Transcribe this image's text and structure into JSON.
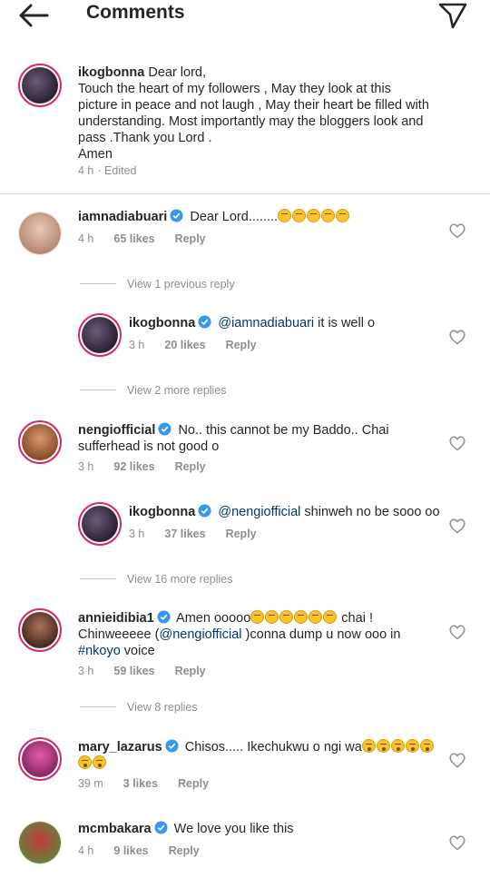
{
  "header": {
    "title": "Comments"
  },
  "caption": {
    "username": "ikogbonna",
    "text_lines": [
      "Dear lord,",
      "Touch the heart of my followers , May they look at this",
      "picture in peace and not laugh , May their heart be filled with",
      "understanding. Most importantly may the bloggers look and",
      "pass .Thank you Lord .",
      "Amen"
    ],
    "time": "4 h",
    "edited": "· Edited"
  },
  "comments": [
    {
      "username": "iamnadiabuari",
      "text": "Dear Lord........",
      "emoji_count": 5,
      "time": "4 h",
      "likes": "65 likes",
      "reply": "Reply"
    },
    {
      "username": "ikogbonna",
      "mention": "@iamnadiabuari",
      "text": " it is well o",
      "time": "3 h",
      "likes": "20 likes",
      "reply": "Reply"
    },
    {
      "username": "nengiofficial",
      "text_line1": "No.. this cannot be my Baddo.. Chai",
      "text_line2": "sufferhead is not good o",
      "time": "3 h",
      "likes": "92 likes",
      "reply": "Reply"
    },
    {
      "username": "ikogbonna",
      "mention": "@nengiofficial",
      "text": " shinweh no be sooo oo",
      "time": "3 h",
      "likes": "37 likes",
      "reply": "Reply"
    },
    {
      "username": "annieidibia1",
      "text_a": "Amen ooooo",
      "text_b": " chai !",
      "text_line2a": "Chinweeeee (",
      "mention": "@nengiofficial",
      "text_line2b": " )conna dump u now ooo in",
      "hashtag": "#nkoyo",
      "text_line3": " voice",
      "time": "3 h",
      "likes": "59 likes",
      "reply": "Reply"
    },
    {
      "username": "mary_lazarus",
      "text": "Chisos..... Ikechukwu o ngi wa",
      "time": "39 m",
      "likes": "3 likes",
      "reply": "Reply"
    },
    {
      "username": "mcmbakara",
      "text": "We love you like this",
      "time": "4 h",
      "likes": "9 likes",
      "reply": "Reply"
    }
  ],
  "view_replies": {
    "previous": "View 1 previous reply",
    "more2": "View 2 more replies",
    "more16": "View 16 more replies",
    "replies8": "View 8 replies"
  },
  "colors": {
    "verified": "#3897f0",
    "mention": "#00376b",
    "muted": "#8e8e8e",
    "story_ring": "#d52b68"
  },
  "icons": {
    "back": "arrow-left-icon",
    "send": "paper-plane-icon",
    "heart": "heart-outline-icon",
    "verified": "verified-badge-icon"
  }
}
